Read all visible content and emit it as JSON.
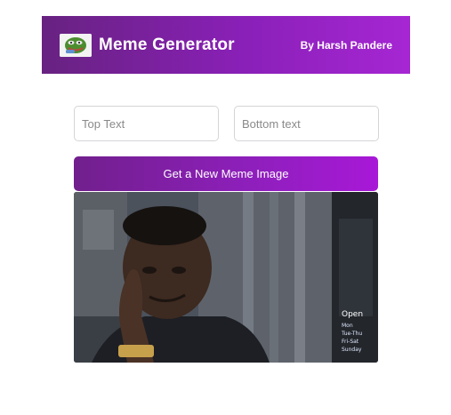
{
  "header": {
    "logo_icon": "troll-face-icon",
    "title": "Meme Generator",
    "author": "By Harsh Pandere"
  },
  "form": {
    "top_text": {
      "value": "",
      "placeholder": "Top Text"
    },
    "bottom_text": {
      "value": "",
      "placeholder": "Bottom text"
    },
    "button_label": "Get a New Meme Image"
  },
  "meme": {
    "image_icon": "roll-safe-meme-image"
  },
  "colors": {
    "header_start": "#672280",
    "header_end": "#a626d3",
    "button_start": "#711f8d",
    "button_end": "#a818d7",
    "input_border": "#d5d4d8"
  }
}
